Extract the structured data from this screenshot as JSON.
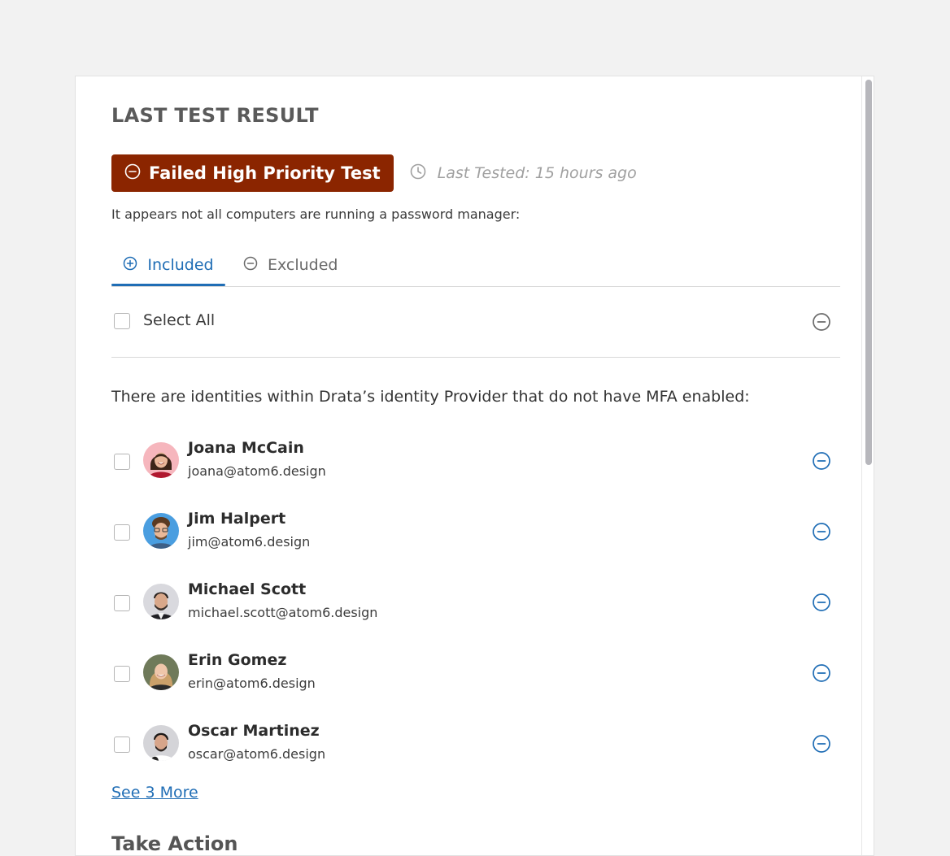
{
  "section": {
    "title": "LAST TEST RESULT",
    "badge_label": "Failed High Priority Test",
    "last_tested": "Last Tested: 15 hours ago",
    "description": "It appears not all computers are running a password manager:"
  },
  "tabs": [
    {
      "label": "Included",
      "active": true
    },
    {
      "label": "Excluded",
      "active": false
    }
  ],
  "select_all_label": "Select All",
  "mfa_message": "There are identities within Drata’s identity Provider that do not have MFA enabled:",
  "people": [
    {
      "name": "Joana McCain",
      "email": "joana@atom6.design"
    },
    {
      "name": "Jim Halpert",
      "email": "jim@atom6.design"
    },
    {
      "name": "Michael Scott",
      "email": "michael.scott@atom6.design"
    },
    {
      "name": "Erin Gomez",
      "email": "erin@atom6.design"
    },
    {
      "name": "Oscar Martinez",
      "email": "oscar@atom6.design"
    }
  ],
  "see_more_label": "See 3 More",
  "next_section_title": "Take Action",
  "colors": {
    "fail": "#8b2500",
    "accent": "#1f6db5",
    "muted": "#a0a0a0"
  }
}
